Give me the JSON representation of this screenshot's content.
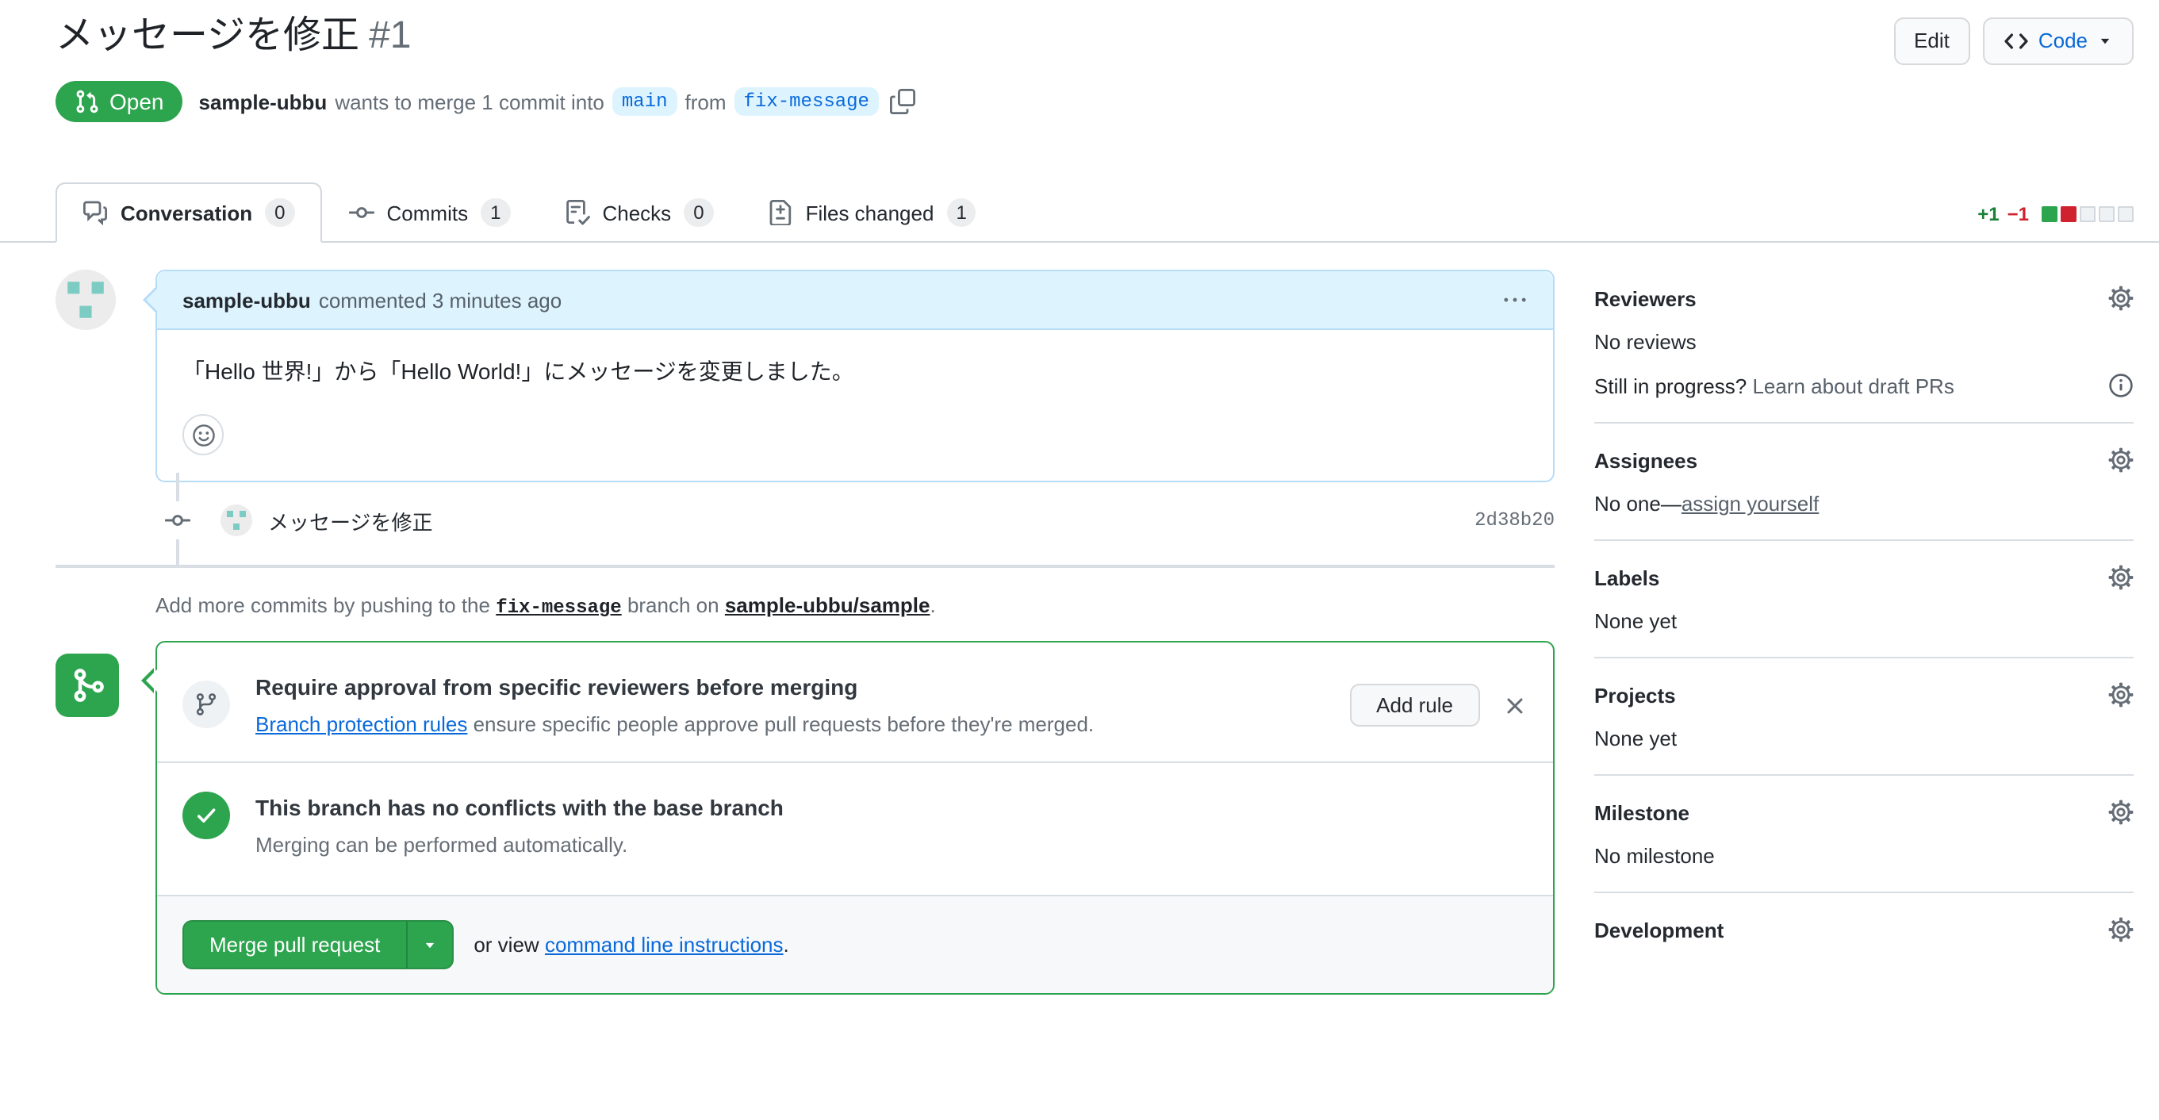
{
  "header": {
    "title": "メッセージを修正",
    "number": "#1",
    "edit_button": "Edit",
    "code_button": "Code",
    "status_badge": "Open",
    "meta": {
      "author": "sample-ubbu",
      "text_before_base": "wants to merge 1 commit into",
      "base_branch": "main",
      "text_between": "from",
      "head_branch": "fix-message"
    }
  },
  "tabs": [
    {
      "label": "Conversation",
      "count": "0"
    },
    {
      "label": "Commits",
      "count": "1"
    },
    {
      "label": "Checks",
      "count": "0"
    },
    {
      "label": "Files changed",
      "count": "1"
    }
  ],
  "diffstat": {
    "additions": "+1",
    "deletions": "−1",
    "blocks": [
      "added",
      "deleted",
      "neutral",
      "neutral",
      "neutral"
    ]
  },
  "comment": {
    "author": "sample-ubbu",
    "action": "commented 3 minutes ago",
    "body": "「Hello 世界!」から「Hello World!」にメッセージを変更しました。"
  },
  "commit": {
    "message": "メッセージを修正",
    "sha": "2d38b20"
  },
  "add_commits": {
    "before": "Add more commits by pushing to the",
    "branch": "fix-message",
    "middle": "branch on",
    "repo": "sample-ubbu/sample",
    "after": "."
  },
  "merge_box": {
    "protection": {
      "title": "Require approval from specific reviewers before merging",
      "link": "Branch protection rules",
      "rest": " ensure specific people approve pull requests before they're merged.",
      "add_rule_button": "Add rule"
    },
    "mergeability": {
      "title": "This branch has no conflicts with the base branch",
      "subtitle": "Merging can be performed automatically."
    },
    "actions": {
      "merge_button": "Merge pull request",
      "or_view": "or view ",
      "cli_link": "command line instructions",
      "period": "."
    }
  },
  "sidebar": {
    "reviewers": {
      "heading": "Reviewers",
      "empty": "No reviews",
      "draft_hint": "Still in progress? ",
      "draft_link": "Learn about draft PRs"
    },
    "assignees": {
      "heading": "Assignees",
      "empty": "No one—",
      "self_assign_link": "assign yourself"
    },
    "labels": {
      "heading": "Labels",
      "empty": "None yet"
    },
    "projects": {
      "heading": "Projects",
      "empty": "None yet"
    },
    "milestone": {
      "heading": "Milestone",
      "empty": "No milestone"
    },
    "development": {
      "heading": "Development"
    }
  },
  "colors": {
    "open_green": "#2da44e",
    "link_blue": "#0969da",
    "branch_label_bg": "#ddf4ff",
    "additions_green": "#1a7f37",
    "deletions_red": "#cf222e"
  }
}
